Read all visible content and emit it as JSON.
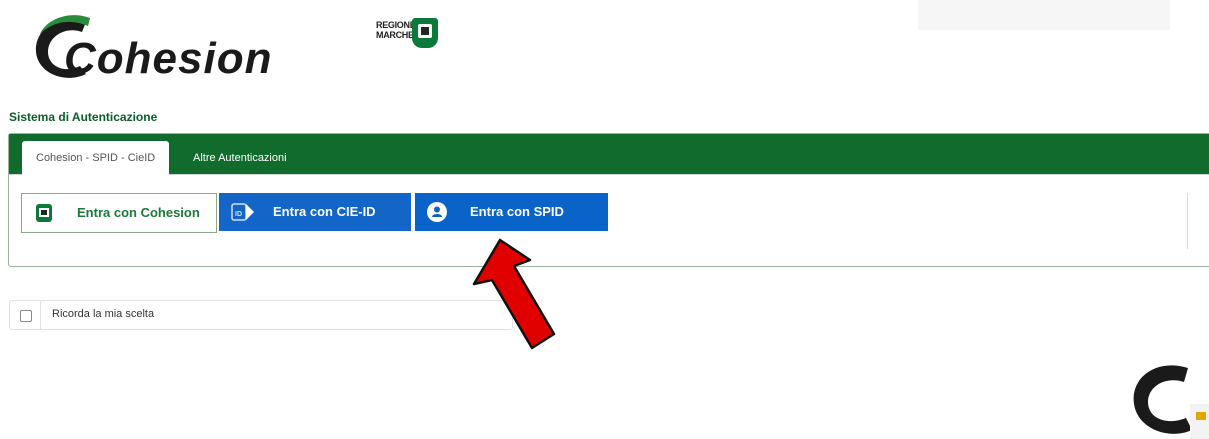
{
  "header": {
    "logo_text": "Cohesion",
    "region_logo_text_line1": "REGIONE",
    "region_logo_text_line2": "MARCHE"
  },
  "system_title": "Sistema di Autenticazione",
  "tabs": [
    {
      "label": "Cohesion - SPID - CieID",
      "active": true
    },
    {
      "label": "Altre Autenticazioni",
      "active": false
    }
  ],
  "login_buttons": [
    {
      "label": "Entra con Cohesion",
      "icon": "regione-marche-emblem-icon"
    },
    {
      "label": "Entra con CIE-ID",
      "icon": "cie-id-icon"
    },
    {
      "label": "Entra con SPID",
      "icon": "spid-user-icon"
    }
  ],
  "remember": {
    "label": "Ricorda la mia scelta",
    "checked": false
  },
  "colors": {
    "green": "#106b2c",
    "blue": "#0a63c9",
    "arrow_red": "#e00000"
  }
}
